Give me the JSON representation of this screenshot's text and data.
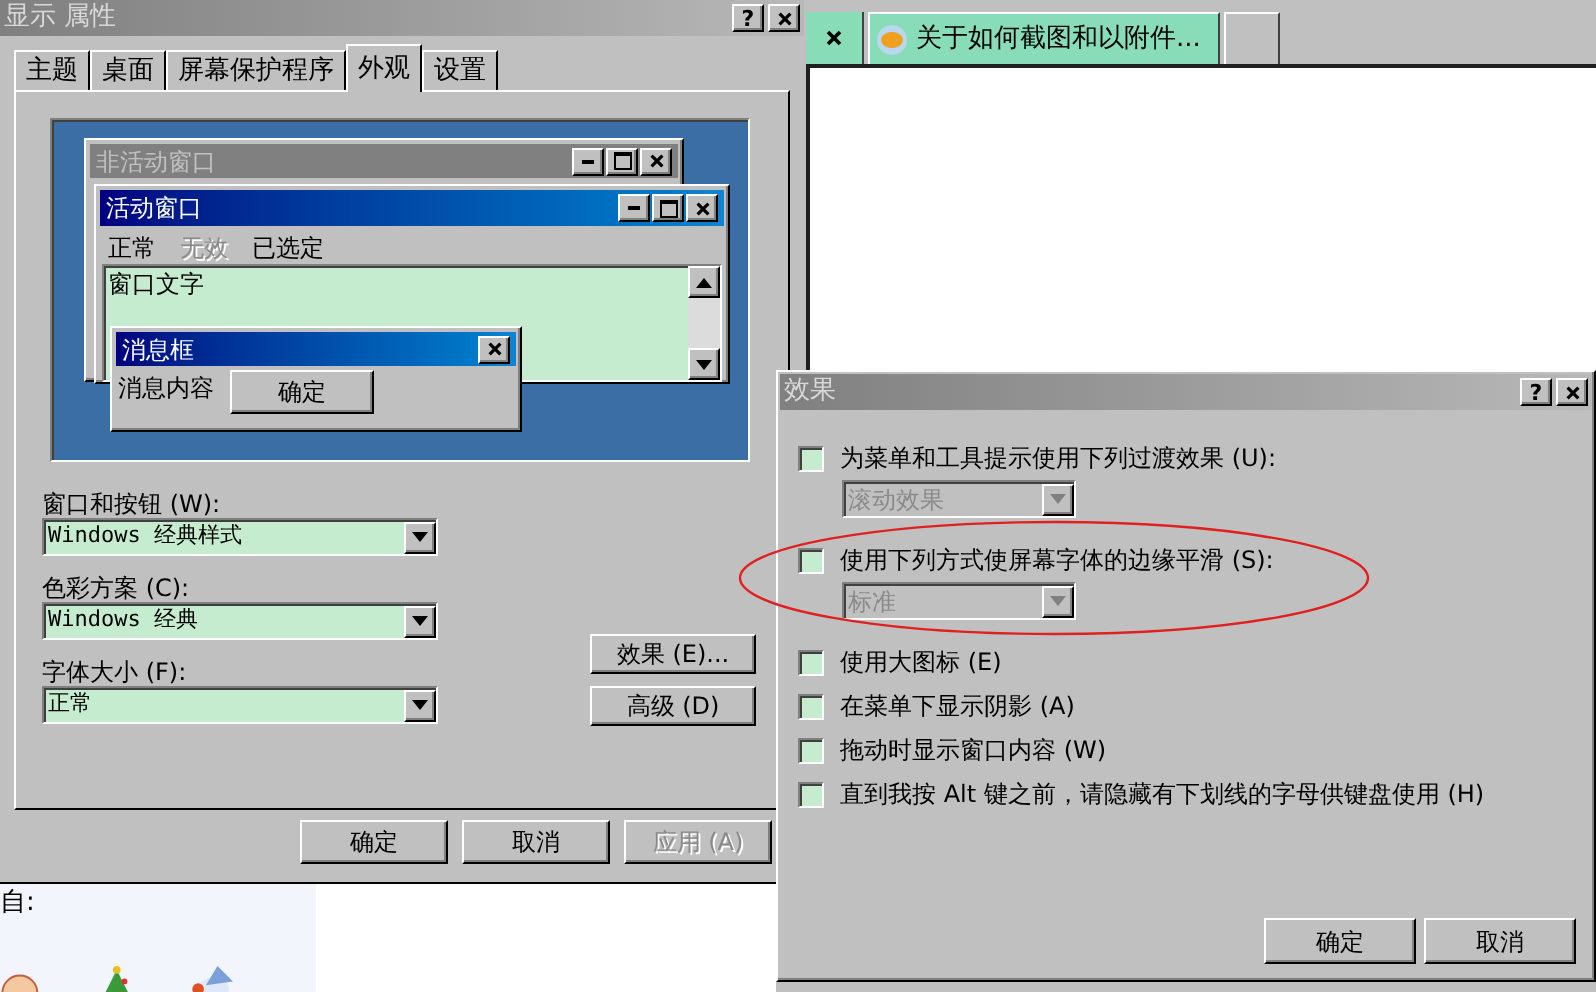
{
  "display_properties": {
    "title": "显示 属性",
    "help_button": "?",
    "tabs": [
      {
        "label": "主题",
        "selected": false
      },
      {
        "label": "桌面",
        "selected": false
      },
      {
        "label": "屏幕保护程序",
        "selected": false
      },
      {
        "label": "外观",
        "selected": true
      },
      {
        "label": "设置",
        "selected": false
      }
    ],
    "preview": {
      "inactive_window_title": "非活动窗口",
      "active_window_title": "活动窗口",
      "menu": [
        {
          "label": "正常",
          "disabled": false
        },
        {
          "label": "无效",
          "disabled": true
        },
        {
          "label": "已选定",
          "disabled": false
        }
      ],
      "window_text": "窗口文字",
      "message_box": {
        "title": "消息框",
        "text": "消息内容",
        "button": "确定"
      }
    },
    "fields": [
      {
        "label": "窗口和按钮 (W):",
        "value": "Windows 经典样式"
      },
      {
        "label": "色彩方案 (C):",
        "value": "Windows 经典"
      },
      {
        "label": "字体大小 (F):",
        "value": "正常"
      }
    ],
    "side_buttons": [
      "效果 (E)...",
      "高级 (D)"
    ],
    "buttons": [
      {
        "label": "确定",
        "disabled": false
      },
      {
        "label": "取消",
        "disabled": false
      },
      {
        "label": "应用 (A)",
        "disabled": true
      }
    ]
  },
  "lower_panel": {
    "label": "自:"
  },
  "browser": {
    "tab_title": "关于如何截图和以附件..."
  },
  "effects": {
    "title": "效果",
    "help_button": "?",
    "options": [
      {
        "label": "为菜单和工具提示使用下列过渡效果 (U):",
        "checked": false,
        "dropdown": {
          "value": "滚动效果",
          "disabled": true
        }
      },
      {
        "label": "使用下列方式使屏幕字体的边缘平滑 (S):",
        "checked": false,
        "dropdown": {
          "value": "标准",
          "disabled": true
        }
      },
      {
        "label": "使用大图标 (E)",
        "checked": false
      },
      {
        "label": "在菜单下显示阴影 (A)",
        "checked": false
      },
      {
        "label": "拖动时显示窗口内容 (W)",
        "checked": false
      },
      {
        "label": "直到我按 Alt 键之前，请隐藏有下划线的字母供键盘使用 (H)",
        "checked": false
      }
    ],
    "buttons": [
      "确定",
      "取消"
    ]
  }
}
